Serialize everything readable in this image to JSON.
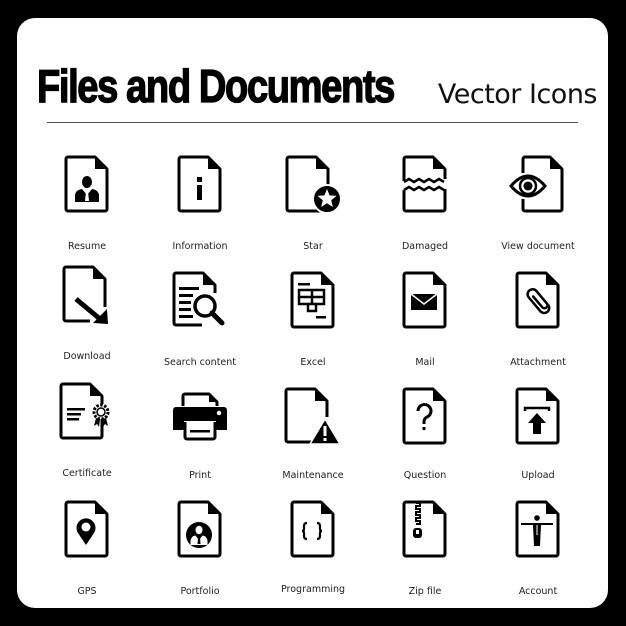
{
  "header": {
    "title": "Files and Documents",
    "subtitle": "Vector Icons"
  },
  "colors": {
    "background": "#000000",
    "card": "#ffffff",
    "icon": "#000000",
    "label": "#222222"
  },
  "icons": [
    {
      "label": "Resume",
      "icon": "resume-icon"
    },
    {
      "label": "Information",
      "icon": "information-icon"
    },
    {
      "label": "Star",
      "icon": "star-icon"
    },
    {
      "label": "Damaged",
      "icon": "damaged-icon"
    },
    {
      "label": "View document",
      "icon": "view-document-icon"
    },
    {
      "label": "Download",
      "icon": "download-icon"
    },
    {
      "label": "Search content",
      "icon": "search-content-icon"
    },
    {
      "label": "Excel",
      "icon": "excel-icon"
    },
    {
      "label": "Mail",
      "icon": "mail-icon"
    },
    {
      "label": "Attachment",
      "icon": "attachment-icon"
    },
    {
      "label": "Certificate",
      "icon": "certificate-icon"
    },
    {
      "label": "Print",
      "icon": "print-icon"
    },
    {
      "label": "Maintenance",
      "icon": "maintenance-icon"
    },
    {
      "label": "Question",
      "icon": "question-icon"
    },
    {
      "label": "Upload",
      "icon": "upload-icon"
    },
    {
      "label": "GPS",
      "icon": "gps-icon"
    },
    {
      "label": "Portfolio",
      "icon": "portfolio-icon"
    },
    {
      "label": "Programming",
      "icon": "programming-icon"
    },
    {
      "label": "Zip file",
      "icon": "zip-file-icon"
    },
    {
      "label": "Account",
      "icon": "account-icon"
    }
  ]
}
